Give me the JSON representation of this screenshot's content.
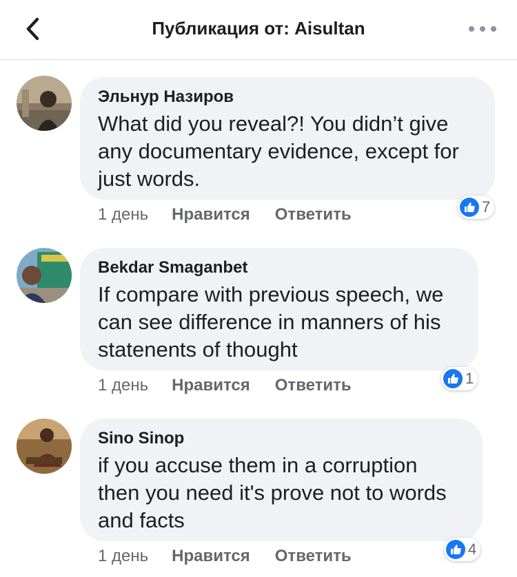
{
  "header": {
    "title": "Публикация от: Aisultan",
    "back_icon": "chevron-left-icon",
    "more_icon": "more-horizontal-icon"
  },
  "comments": [
    {
      "author": "Эльнур Назиров",
      "text": "What did you reveal?! You didn’t give any documentary evidence, except for just words.",
      "time": "1 день",
      "like_label": "Нравится",
      "reply_label": "Ответить",
      "reaction_icon": "like-icon",
      "reaction_count": "7"
    },
    {
      "author": "Bekdar Smaganbet",
      "text": "If compare with previous speech, we can see difference in manners of his statenents of thought",
      "time": "1 день",
      "like_label": "Нравится",
      "reply_label": "Ответить",
      "reaction_icon": "like-icon",
      "reaction_count": "1"
    },
    {
      "author": "Sino Sinop",
      "text": "if you accuse them in a corruption then you need it's prove not to words and facts",
      "time": "1 день",
      "like_label": "Нравится",
      "reply_label": "Ответить",
      "reaction_icon": "like-icon",
      "reaction_count": "4"
    }
  ],
  "colors": {
    "bubble": "#f0f2f5",
    "like_blue": "#1877f2",
    "meta_gray": "#65676b"
  }
}
